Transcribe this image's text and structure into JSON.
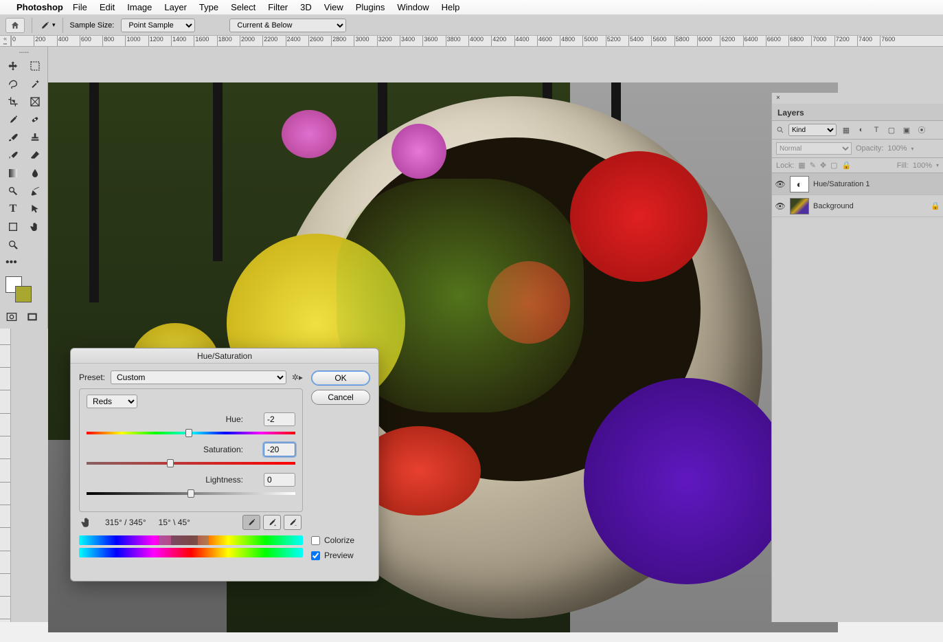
{
  "menubar": {
    "app": "Photoshop",
    "items": [
      "File",
      "Edit",
      "Image",
      "Layer",
      "Type",
      "Select",
      "Filter",
      "3D",
      "View",
      "Plugins",
      "Window",
      "Help"
    ]
  },
  "optbar": {
    "sample_label": "Sample Size:",
    "sample_value": "Point Sample",
    "sample_mode": "Current & Below"
  },
  "ruler_ticks": [
    "0",
    "200",
    "400",
    "600",
    "800",
    "1000",
    "1200",
    "1400",
    "1600",
    "1800",
    "2000",
    "2200",
    "2400",
    "2600",
    "2800",
    "3000",
    "3200",
    "3400",
    "3600",
    "3800",
    "4000",
    "4200",
    "4400",
    "4600",
    "4800",
    "5000",
    "5200",
    "5400",
    "5600",
    "5800",
    "6000",
    "6200",
    "6400",
    "6600",
    "6800",
    "7000",
    "7200",
    "7400",
    "7600"
  ],
  "dialog": {
    "title": "Hue/Saturation",
    "preset_label": "Preset:",
    "preset_value": "Custom",
    "channel": "Reds",
    "hue_label": "Hue:",
    "hue_value": "-2",
    "sat_label": "Saturation:",
    "sat_value": "-20",
    "light_label": "Lightness:",
    "light_value": "0",
    "ok": "OK",
    "cancel": "Cancel",
    "colorize": "Colorize",
    "preview": "Preview",
    "range_left": "315° / 345°",
    "range_right": "15° \\ 45°"
  },
  "layers": {
    "tab": "Layers",
    "kind": "Kind",
    "blend": "Normal",
    "opacity_label": "Opacity:",
    "opacity": "100%",
    "lock_label": "Lock:",
    "fill_label": "Fill:",
    "fill": "100%",
    "items": [
      {
        "name": "Hue/Saturation 1",
        "selected": true,
        "locked": false,
        "adjust": true
      },
      {
        "name": "Background",
        "selected": false,
        "locked": true,
        "adjust": false
      }
    ]
  }
}
